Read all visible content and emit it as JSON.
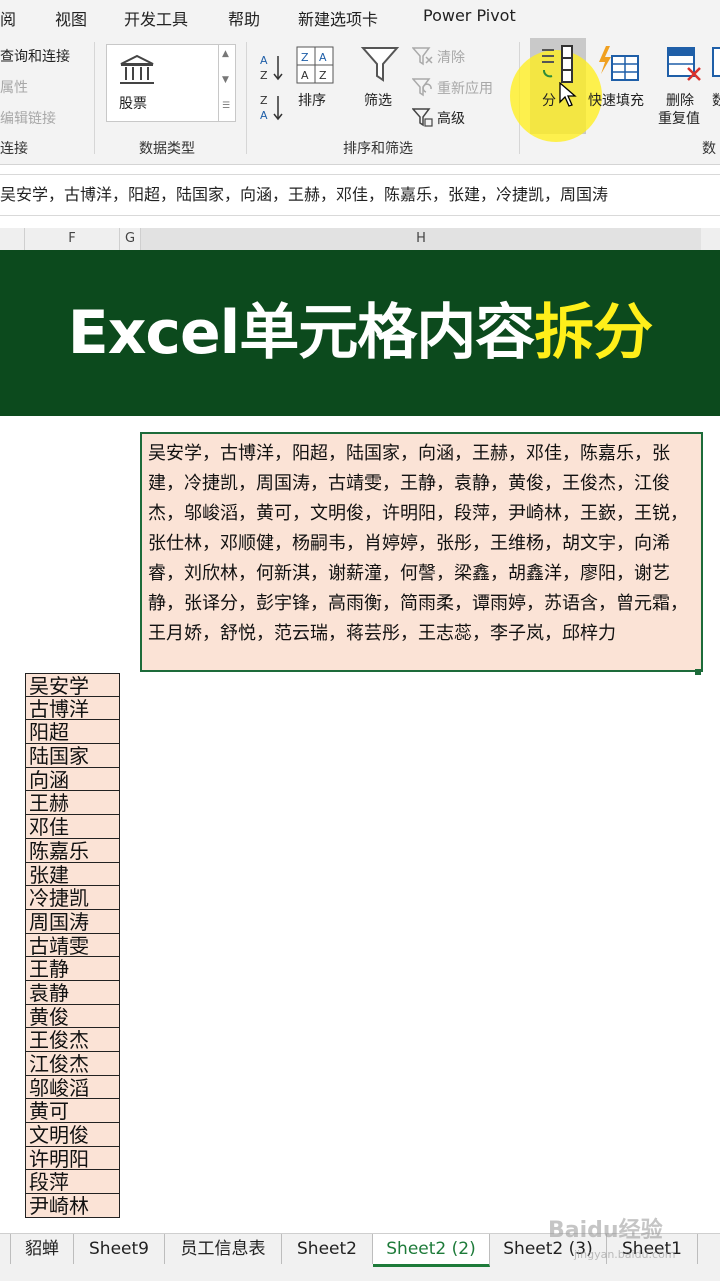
{
  "menu": {
    "tabs": [
      "阅",
      "视图",
      "开发工具",
      "帮助",
      "新建选项卡",
      "Power Pivot"
    ]
  },
  "ribbon": {
    "connections": {
      "items": [
        "查询和连接",
        "属性",
        "编辑链接"
      ],
      "group_label": "连接"
    },
    "data_types": {
      "stock_label": "股票",
      "group_label": "数据类型"
    },
    "sort_filter": {
      "sort_label": "排序",
      "filter_label": "筛选",
      "clear_label": "清除",
      "reapply_label": "重新应用",
      "advanced_label": "高级",
      "group_label": "排序和筛选"
    },
    "data_tools": {
      "split_label": "分",
      "flash_fill_label": "快速填充",
      "remove_duplicates_label": "删除\n重复值",
      "more_label": "数",
      "group_label": "数"
    }
  },
  "formula_bar": {
    "content": "吴安学，古博洋，阳超，陆国家，向涵，王赫，邓佳，陈嘉乐，张建，冷捷凯，周国涛"
  },
  "columns": [
    "F",
    "G",
    "H"
  ],
  "banner": {
    "title_main": "Excel单元格内容",
    "title_highlight": "拆分",
    "bg_color": "#0c4a1d",
    "highlight_color": "#ffef1a"
  },
  "merged_cell": {
    "text": "吴安学，古博洋，阳超，陆国家，向涵，王赫，邓佳，陈嘉乐，张建，冷捷凯，周国涛，古靖雯，王静，袁静，黄俊，王俊杰，江俊杰，邬峻滔，黄可，文明俊，许明阳，段萍，尹崎林，王嶔，王锐，张仕林，邓顺健，杨嗣韦，肖婷婷，张彤，王维杨，胡文宇，向浠睿，刘欣林，何新淇，谢薪潼，何謦，梁鑫，胡鑫洋，廖阳，谢艺静，张译分，彭宇锋，高雨衡，简雨柔，谭雨婷，苏语含，曾元霜，王月娇，舒悦，范云瑞，蒋芸彤，王志蕊，李子岚，邱梓力",
    "fill_color": "#fbe3d6"
  },
  "split_list": [
    "吴安学",
    "古博洋",
    "阳超",
    "陆国家",
    "向涵",
    "王赫",
    "邓佳",
    "陈嘉乐",
    "张建",
    "冷捷凯",
    "周国涛",
    "古靖雯",
    "王静",
    "袁静",
    "黄俊",
    "王俊杰",
    "江俊杰",
    "邬峻滔",
    "黄可",
    "文明俊",
    "许明阳",
    "段萍",
    "尹崎林"
  ],
  "sheet_tabs": {
    "tabs": [
      "貂蝉",
      "Sheet9",
      "员工信息表",
      "Sheet2",
      "Sheet2 (2)",
      "Sheet2 (3)",
      "Sheet1"
    ],
    "active": "Sheet2 (2)",
    "accent_color": "#1e7b3a"
  },
  "watermark": {
    "text": "Baidu经验",
    "sub": "jingyan.baidu.com"
  }
}
